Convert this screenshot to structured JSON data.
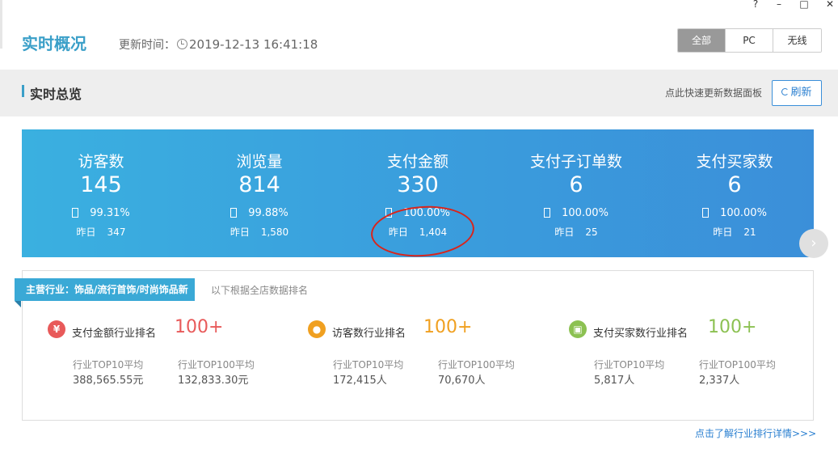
{
  "window": {
    "controls": [
      "?",
      "–",
      "□",
      "✕"
    ]
  },
  "header": {
    "title": "实时概况",
    "update_label": "更新时间：",
    "update_time": "2019-12-13 16:41:18",
    "segments": [
      "全部",
      "PC",
      "无线"
    ],
    "active_segment": "全部"
  },
  "overview": {
    "title": "实时总览",
    "hint": "点此快速更新数据面板",
    "refresh_label": "刷新"
  },
  "stats": [
    {
      "label": "访客数",
      "value": "145",
      "pct": "99.31%",
      "yest_label": "昨日",
      "yest_value": "347"
    },
    {
      "label": "浏览量",
      "value": "814",
      "pct": "99.88%",
      "yest_label": "昨日",
      "yest_value": "1,580"
    },
    {
      "label": "支付金额",
      "value": "330",
      "pct": "100.00%",
      "yest_label": "昨日",
      "yest_value": "1,404"
    },
    {
      "label": "支付子订单数",
      "value": "6",
      "pct": "100.00%",
      "yest_label": "昨日",
      "yest_value": "25"
    },
    {
      "label": "支付买家数",
      "value": "6",
      "pct": "100.00%",
      "yest_label": "昨日",
      "yest_value": "21"
    }
  ],
  "industry": {
    "tag": "主营行业：饰品/流行首饰/时尚饰品新",
    "note": "以下根据全店数据排名",
    "ranks": [
      {
        "icon": "yen-icon",
        "icon_glyph": "¥",
        "color": "#e85a5a",
        "label": "支付金额行业排名",
        "value": "100+",
        "top10_label": "行业TOP10平均",
        "top10_value": "388,565.55元",
        "top100_label": "行业TOP100平均",
        "top100_value": "132,833.30元"
      },
      {
        "icon": "user-icon",
        "icon_glyph": "●",
        "color": "#f0a020",
        "label": "访客数行业排名",
        "value": "100+",
        "top10_label": "行业TOP10平均",
        "top10_value": "172,415人",
        "top100_label": "行业TOP100平均",
        "top100_value": "70,670人"
      },
      {
        "icon": "wallet-icon",
        "icon_glyph": "▣",
        "color": "#8cc152",
        "label": "支付买家数行业排名",
        "value": "100+",
        "top10_label": "行业TOP10平均",
        "top10_value": "5,817人",
        "top100_label": "行业TOP100平均",
        "top100_value": "2,337人"
      }
    ],
    "detail_link": "点击了解行业排行详情>>>"
  }
}
